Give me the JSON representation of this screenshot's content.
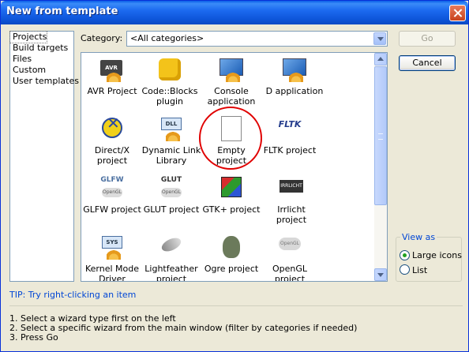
{
  "window": {
    "title": "New from template"
  },
  "type_list": [
    "Projects",
    "Build targets",
    "Files",
    "Custom",
    "User templates"
  ],
  "category": {
    "label": "Category:",
    "value": "<All categories>"
  },
  "tiles": [
    {
      "label": "AVR Project",
      "icon": "avr-chip-icon"
    },
    {
      "label": "Code::Blocks plugin",
      "icon": "puzzle-piece-icon"
    },
    {
      "label": "Console application",
      "icon": "console-window-icon"
    },
    {
      "label": "D application",
      "icon": "d-app-icon"
    },
    {
      "label": "Direct/X project",
      "icon": "directx-icon"
    },
    {
      "label": "Dynamic Link Library",
      "icon": "dll-icon"
    },
    {
      "label": "Empty project",
      "icon": "blank-document-icon"
    },
    {
      "label": "FLTK project",
      "icon": "fltk-logo-icon"
    },
    {
      "label": "GLFW project",
      "icon": "glfw-logo-icon"
    },
    {
      "label": "GLUT project",
      "icon": "glut-logo-icon"
    },
    {
      "label": "GTK+ project",
      "icon": "gtk-cube-icon"
    },
    {
      "label": "Irrlicht project",
      "icon": "irrlicht-logo-icon"
    },
    {
      "label": "Kernel Mode Driver",
      "icon": "sys-driver-icon"
    },
    {
      "label": "Lightfeather project",
      "icon": "feather-icon"
    },
    {
      "label": "Ogre project",
      "icon": "ogre-head-icon"
    },
    {
      "label": "OpenGL project",
      "icon": "opengl-logo-icon"
    }
  ],
  "icon_text": {
    "avr": "AVR",
    "dll": "DLL",
    "glfw": "GLFW",
    "glut": "GLUT",
    "opengl": "OpenGL",
    "irr": "IRRLICHT",
    "sys": "SYS",
    "fltk": "FLTK"
  },
  "buttons": {
    "go": "Go",
    "cancel": "Cancel"
  },
  "view_as": {
    "legend": "View as",
    "large_icons": "Large icons",
    "list": "List",
    "selected": "Large icons"
  },
  "tip": "TIP: Try right-clicking an item",
  "instructions": [
    "1. Select a wizard type first on the left",
    "2. Select a specific wizard from the main window (filter by categories if needed)",
    "3. Press Go"
  ],
  "colors": {
    "titlebar": "#0a5ee8",
    "dialog_bg": "#ece9d8",
    "tip_text": "#0046d5",
    "highlight_circle": "#e00000"
  }
}
